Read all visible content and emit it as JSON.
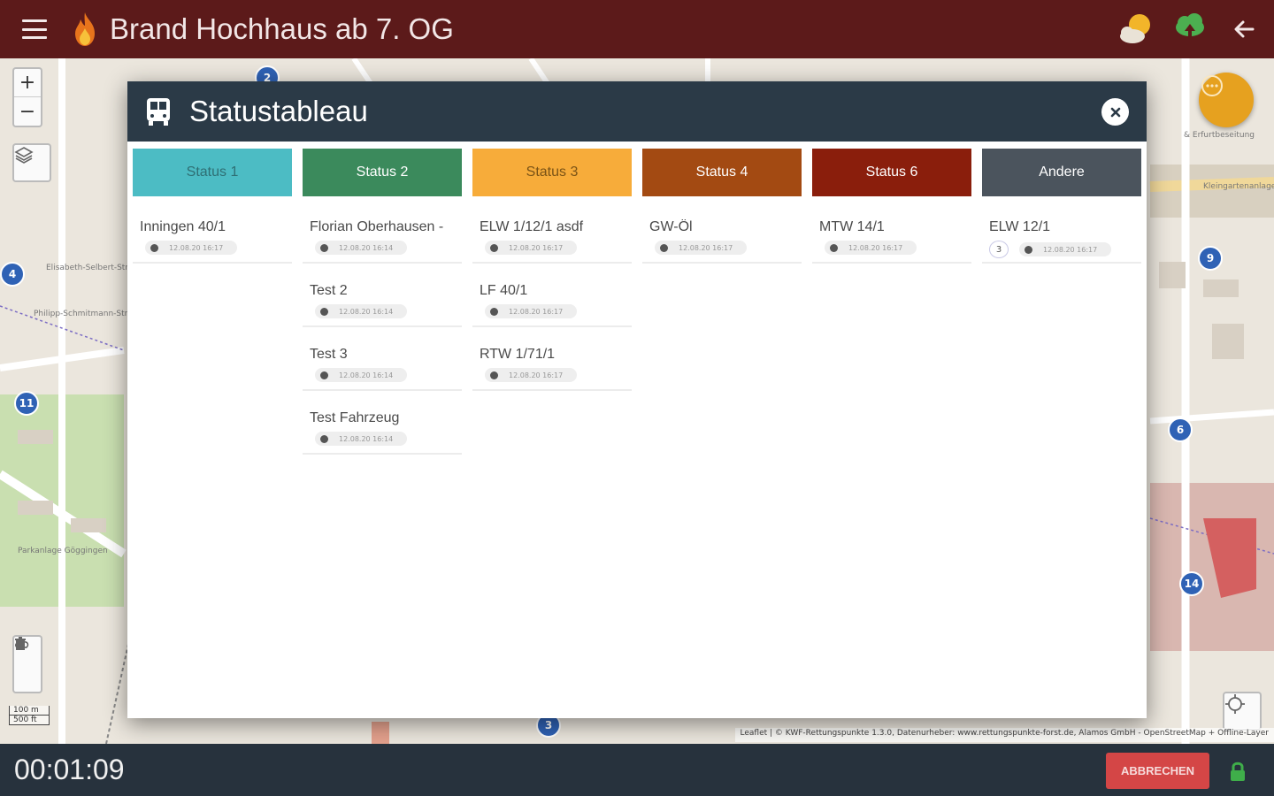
{
  "app": {
    "title": "Brand Hochhaus ab 7. OG"
  },
  "modal": {
    "title": "Statustableau",
    "columns": [
      {
        "label": "Status 1",
        "color": "#4cbcc4",
        "text_color": "#2f6f74",
        "vehicles": [
          {
            "name": "Inningen 40/1",
            "time": "12.08.20 16:17",
            "count": ""
          }
        ]
      },
      {
        "label": "Status 2",
        "color": "#3b8a5c",
        "text_color": "#ffffff",
        "vehicles": [
          {
            "name": "Florian Oberhausen -",
            "time": "12.08.20 16:14",
            "count": ""
          },
          {
            "name": "Test 2",
            "time": "12.08.20 16:14",
            "count": ""
          },
          {
            "name": "Test 3",
            "time": "12.08.20 16:14",
            "count": ""
          },
          {
            "name": "Test Fahrzeug",
            "time": "12.08.20 16:14",
            "count": ""
          }
        ]
      },
      {
        "label": "Status 3",
        "color": "#f7ac3a",
        "text_color": "#7a5316",
        "vehicles": [
          {
            "name": "ELW 1/12/1 asdf",
            "time": "12.08.20 16:17",
            "count": ""
          },
          {
            "name": "LF 40/1",
            "time": "12.08.20 16:17",
            "count": ""
          },
          {
            "name": "RTW 1/71/1",
            "time": "12.08.20 16:17",
            "count": ""
          }
        ]
      },
      {
        "label": "Status 4",
        "color": "#a34a12",
        "text_color": "#ffffff",
        "vehicles": [
          {
            "name": "GW-Öl",
            "time": "12.08.20 16:17",
            "count": ""
          }
        ]
      },
      {
        "label": "Status 6",
        "color": "#8a1e0c",
        "text_color": "#ffffff",
        "vehicles": [
          {
            "name": "MTW 14/1",
            "time": "12.08.20 16:17",
            "count": ""
          }
        ]
      },
      {
        "label": "Andere",
        "color": "#4b545d",
        "text_color": "#ffffff",
        "vehicles": [
          {
            "name": "ELW 12/1",
            "time": "12.08.20 16:17",
            "count": "3"
          }
        ]
      }
    ]
  },
  "map": {
    "markers": [
      {
        "label": "4"
      },
      {
        "label": "11"
      },
      {
        "label": "9"
      },
      {
        "label": "6"
      },
      {
        "label": "14"
      },
      {
        "label": "3"
      },
      {
        "label": "2"
      }
    ],
    "zoom_in": "+",
    "zoom_out": "−",
    "scale_metric": "100 m",
    "scale_imperial": "500 ft",
    "attribution": "Leaflet | © KWF-Rettungspunkte 1.3.0, Datenurheber: www.rettungspunkte-forst.de, Alamos GmbH - OpenStreetMap + Offline-Layer",
    "labels": [
      {
        "text": "Parkanlage Göggingen"
      },
      {
        "text": "Philipp-Schmitmann-Str."
      },
      {
        "text": "Elisabeth-Selbert-Str."
      },
      {
        "text": "Kleingartenanlage"
      },
      {
        "text": "& Erfurtbeseitung"
      }
    ]
  },
  "footer": {
    "timer": "00:01:09",
    "cancel_label": "ABBRECHEN"
  },
  "colors": {
    "appbar": "#5c1a1a",
    "modal_header": "#2b3a47",
    "bottombar": "#27323d",
    "fab": "#e6a11f",
    "cancel": "#d44646",
    "marker": "#2f62b5"
  },
  "icons": [
    "menu-icon",
    "flame-icon",
    "weather-icon",
    "cloud-upload-icon",
    "back-arrow-icon",
    "bus-icon",
    "close-icon",
    "chat-icon",
    "layers-icon",
    "cloud-sync-icon",
    "trash-icon",
    "locate-icon",
    "lock-icon",
    "clock-icon"
  ]
}
